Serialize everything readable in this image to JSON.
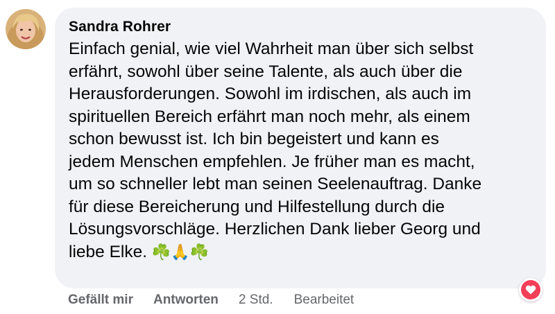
{
  "comment": {
    "author": "Sandra Rohrer",
    "lines": [
      "Einfach genial, wie viel Wahrheit man über sich selbst",
      "erfährt, sowohl über seine Talente, als auch über die",
      "Herausforderungen. Sowohl im irdischen, als auch im",
      "spirituellen Bereich erfährt man noch mehr, als einem",
      "schon bewusst ist. Ich bin begeistert und kann es",
      "jedem Menschen empfehlen. Je früher man es macht,",
      "um so schneller lebt man seinen Seelenauftrag. Danke",
      "für diese Bereicherung und Hilfestellung durch die",
      "Lösungsvorschläge. Herzlichen Dank lieber Georg und",
      "liebe Elke."
    ],
    "emojis": [
      "☘️",
      "🙏",
      "☘️"
    ]
  },
  "actions": {
    "like": "Gefällt mir",
    "reply": "Antworten",
    "time": "2 Std.",
    "edited": "Bearbeitet"
  },
  "reaction": {
    "icon": "heart-icon",
    "color": "#f33e58"
  },
  "colors": {
    "bubble": "#f0f2f5",
    "text": "#050505",
    "meta": "#65676b"
  }
}
